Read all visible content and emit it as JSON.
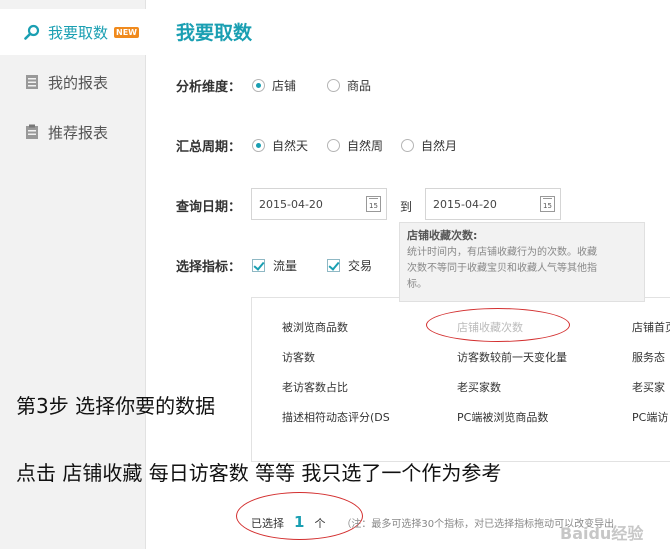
{
  "sidebar": {
    "items": [
      {
        "label": "我要取数",
        "badge": "NEW",
        "icon": "search-icon"
      },
      {
        "label": "我的报表",
        "icon": "list-icon"
      },
      {
        "label": "推荐报表",
        "icon": "clipboard-icon"
      }
    ]
  },
  "page": {
    "title": "我要取数"
  },
  "dimension": {
    "label": "分析维度：",
    "options": [
      "店铺",
      "商品"
    ],
    "selected": "店铺"
  },
  "period": {
    "label": "汇总周期：",
    "options": [
      "自然天",
      "自然周",
      "自然月"
    ],
    "selected": "自然天"
  },
  "date": {
    "label": "查询日期：",
    "start": "2015-04-20",
    "to": "到",
    "end": "2015-04-20",
    "cal_text": "15"
  },
  "metrics": {
    "label": "选择指标：",
    "options": [
      "流量",
      "交易"
    ],
    "checked": [
      "流量",
      "交易"
    ]
  },
  "tooltip": {
    "title": "店铺收藏次数:",
    "lines": [
      "统计时间内，有店铺收藏行为的次数。收藏",
      "次数不等同于收藏宝贝和收藏人气等其他指",
      "标。"
    ]
  },
  "metric_list": {
    "col1": [
      "被浏览商品数",
      "访客数",
      "老访客数占比",
      "描述相符动态评分(DS"
    ],
    "col2": [
      "店铺收藏次数",
      "访客数较前一天变化量",
      "老买家数",
      "PC端被浏览商品数"
    ],
    "col3": [
      "店铺首页",
      "服务态",
      "老买家",
      "PC端访"
    ]
  },
  "overlay": {
    "line1": "第3步 选择你要的数据",
    "line2": "点击 店铺收藏 每日访客数 等等 我只选了一个作为参考"
  },
  "footer": {
    "prefix": "已选择",
    "count": "1",
    "unit": "个",
    "note": "（注：最多可选择30个指标，对已选择指标拖动可以改变导出"
  },
  "watermark": "Baidu经验",
  "colors": {
    "accent": "#1a9fb2",
    "annotation": "#d32f2f",
    "badge": "#f08a1d"
  }
}
